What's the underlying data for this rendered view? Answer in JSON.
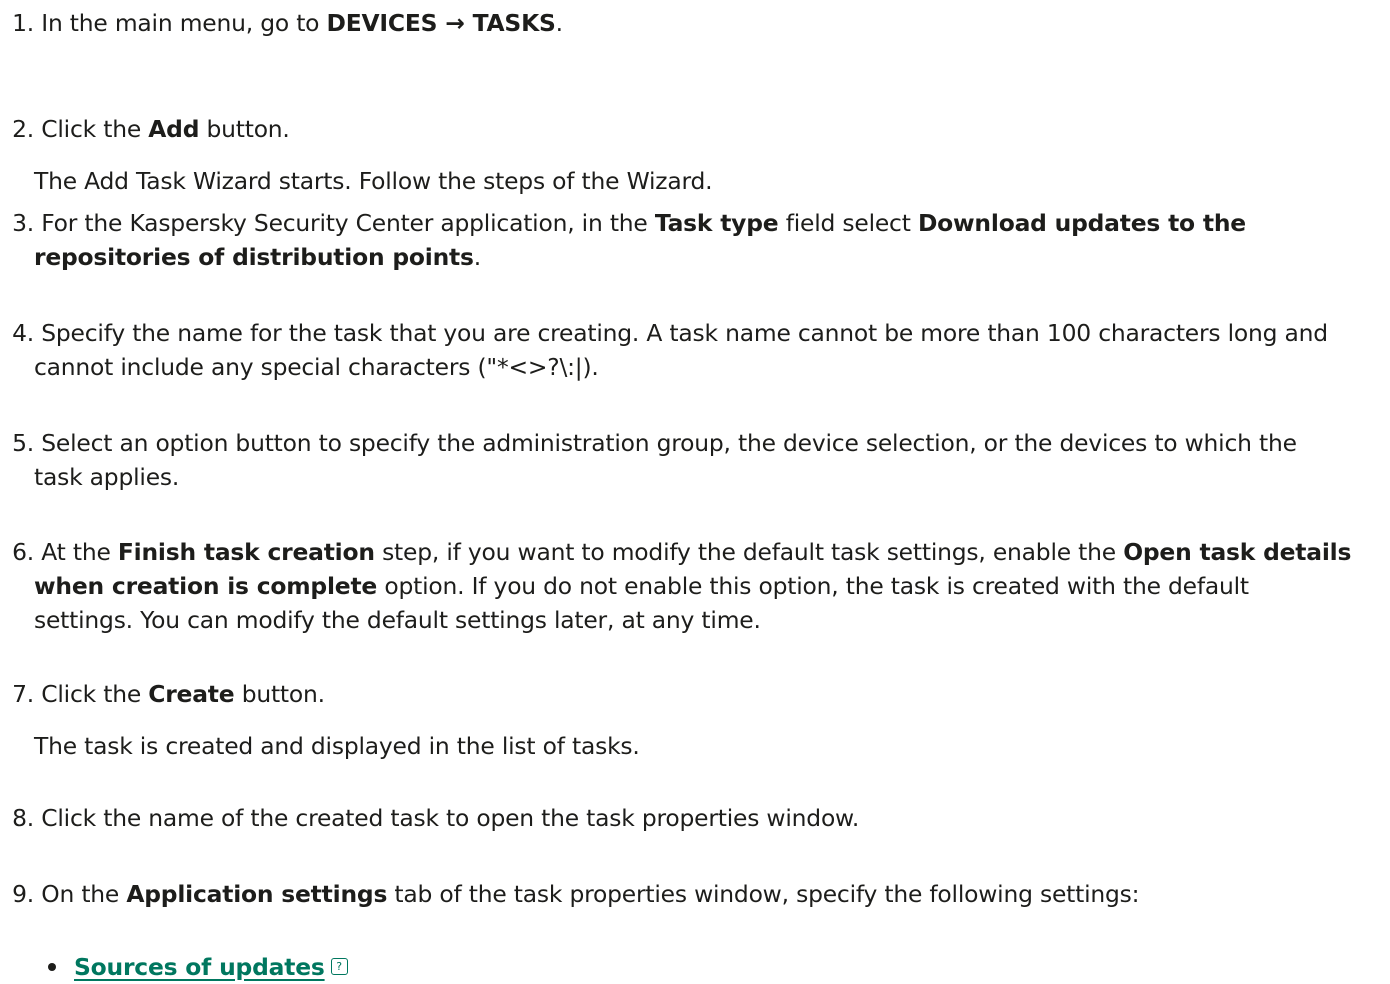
{
  "steps": [
    {
      "num": "1.",
      "pre": "In the main menu, go to ",
      "b1": "DEVICES → TASKS",
      "post": "."
    },
    {
      "num": "2.",
      "pre": "Click the ",
      "b1": "Add",
      "post": " button.",
      "note": "The Add Task Wizard starts. Follow the steps of the Wizard."
    },
    {
      "num": "3.",
      "pre": "For the Kaspersky Security Center application, in the ",
      "b1": "Task type",
      "mid": " field select ",
      "b2a": "Download updates to the",
      "b2b": "repositories of distribution points",
      "post": "."
    },
    {
      "num": "4.",
      "l1": "Specify the name for the task that you are creating. A task name cannot be more than 100 characters long and",
      "l2": "cannot include any special characters (\"*<>?\\:|)."
    },
    {
      "num": "5.",
      "l1": "Select an option button to specify the administration group, the device selection, or the devices to which the",
      "l2": "task applies."
    },
    {
      "num": "6.",
      "pre": "At the ",
      "b1": "Finish task creation",
      "mid": " step, if you want to modify the default task settings, enable the ",
      "b2a": "Open task details",
      "b2b": "when creation is complete",
      "post1": " option. If you do not enable this option, the task is created with the default",
      "l3": "settings. You can modify the default settings later, at any time."
    },
    {
      "num": "7.",
      "pre": "Click the ",
      "b1": "Create",
      "post": " button.",
      "note": "The task is created and displayed in the list of tasks."
    },
    {
      "num": "8.",
      "l1": "Click the name of the created task to open the task properties window."
    },
    {
      "num": "9.",
      "pre": "On the ",
      "b1": "Application settings",
      "post": " tab of the task properties window, specify the following settings:"
    }
  ],
  "bullets": [
    {
      "label": "Sources of updates",
      "icon": "?"
    }
  ]
}
